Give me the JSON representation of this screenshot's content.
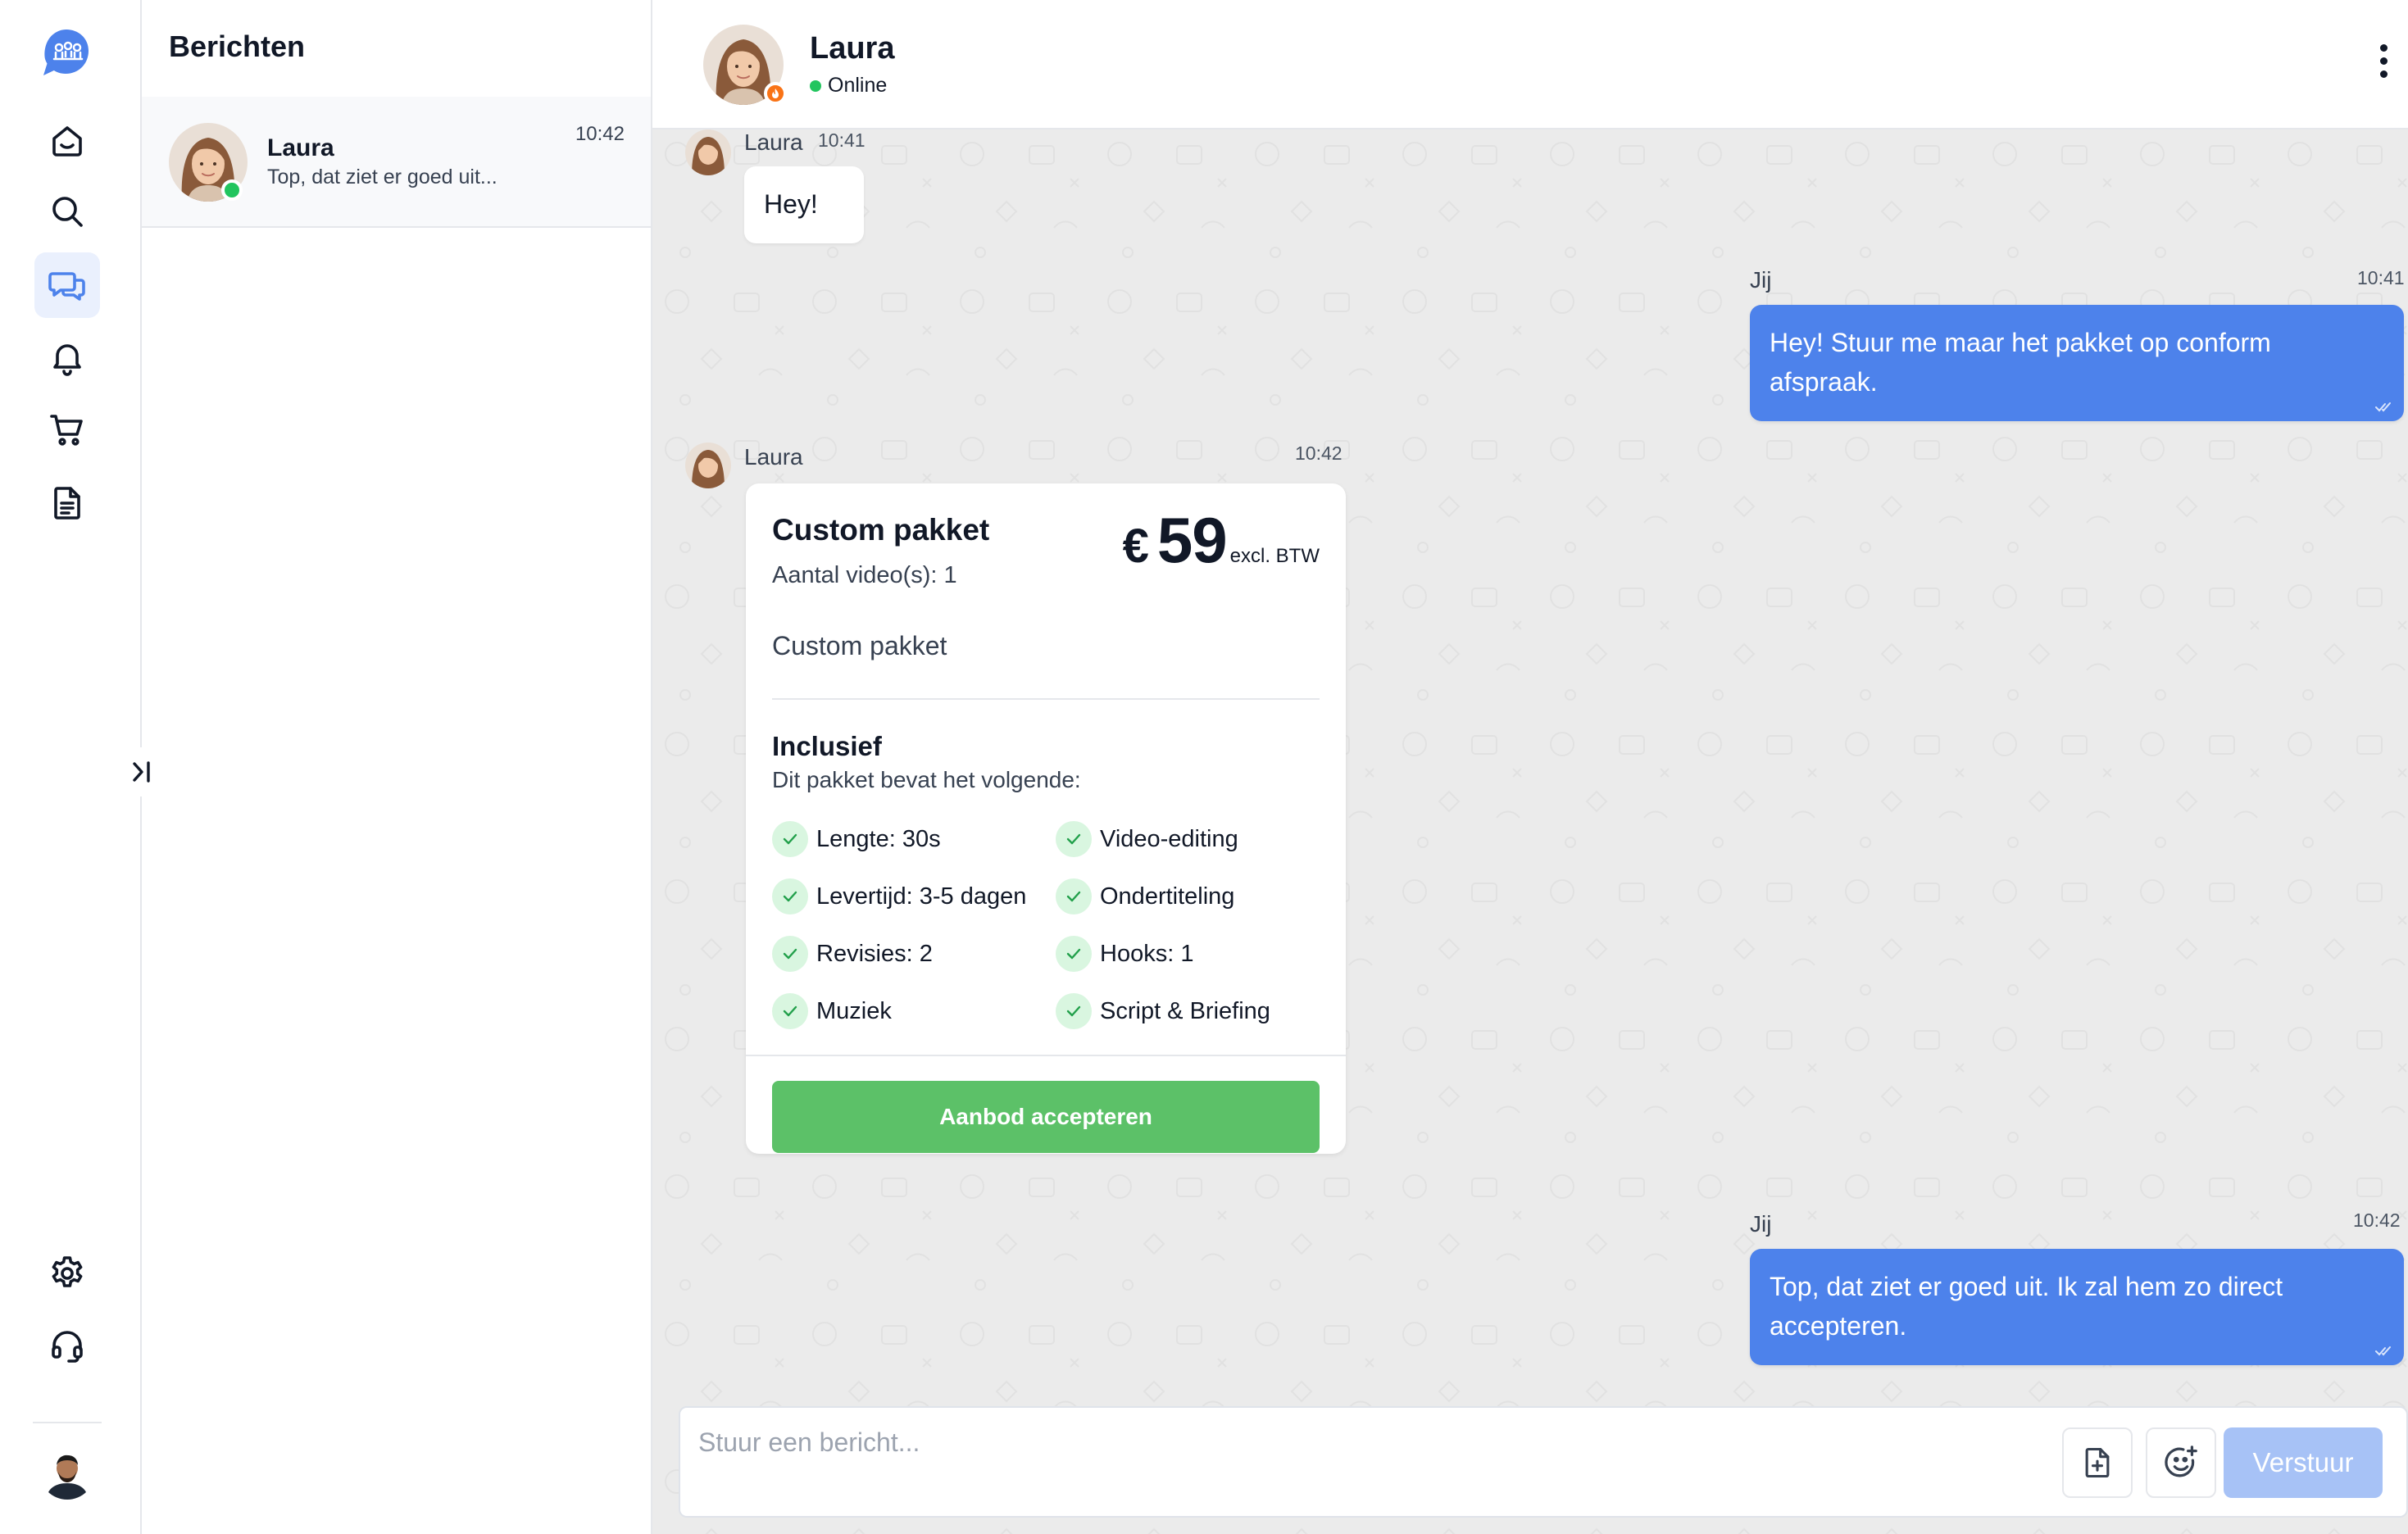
{
  "nav": {
    "logo": "app-logo",
    "items": [
      {
        "name": "home",
        "icon": "home-icon"
      },
      {
        "name": "search",
        "icon": "search-icon"
      },
      {
        "name": "messages",
        "icon": "chat-bubbles-icon",
        "active": true
      },
      {
        "name": "notifications",
        "icon": "bell-icon"
      },
      {
        "name": "cart",
        "icon": "cart-icon"
      },
      {
        "name": "documents",
        "icon": "document-icon"
      },
      {
        "name": "settings",
        "icon": "gear-icon"
      },
      {
        "name": "support",
        "icon": "headset-icon"
      }
    ],
    "accent_color": "#4d82eb"
  },
  "conversations": {
    "title": "Berichten",
    "items": [
      {
        "name": "Laura",
        "preview": "Top, dat ziet er goed uit...",
        "time": "10:42",
        "online": true
      }
    ]
  },
  "chat": {
    "contact_name": "Laura",
    "status": "Online",
    "messages": [
      {
        "sender": "Laura",
        "time": "10:41",
        "text": "Hey!"
      },
      {
        "sender": "Jij",
        "time": "10:41",
        "text": "Hey! Stuur me maar het pakket op conform afspraak."
      },
      {
        "sender": "Laura",
        "time": "10:42",
        "type": "offer"
      },
      {
        "sender": "Jij",
        "time": "10:42",
        "text": "Top, dat ziet er goed uit. Ik zal hem zo direct accepteren."
      }
    ],
    "offer": {
      "title": "Custom pakket",
      "videos": "Aantal video(s): 1",
      "currency": "€",
      "price": "59",
      "tax_note": "excl. BTW",
      "description": "Custom pakket",
      "included_title": "Inclusief",
      "included_subtitle": "Dit pakket bevat het volgende:",
      "features": [
        "Lengte: 30s",
        "Video-editing",
        "Levertijd: 3-5 dagen",
        "Ondertiteling",
        "Revisies: 2",
        "Hooks: 1",
        "Muziek",
        "Script & Briefing"
      ],
      "accept_label": "Aanbod accepteren",
      "accept_color": "#5cc168"
    }
  },
  "composer": {
    "placeholder": "Stuur een bericht...",
    "send_label": "Verstuur",
    "attach_icon": "file-plus-icon",
    "emoji_icon": "emoji-plus-icon"
  }
}
